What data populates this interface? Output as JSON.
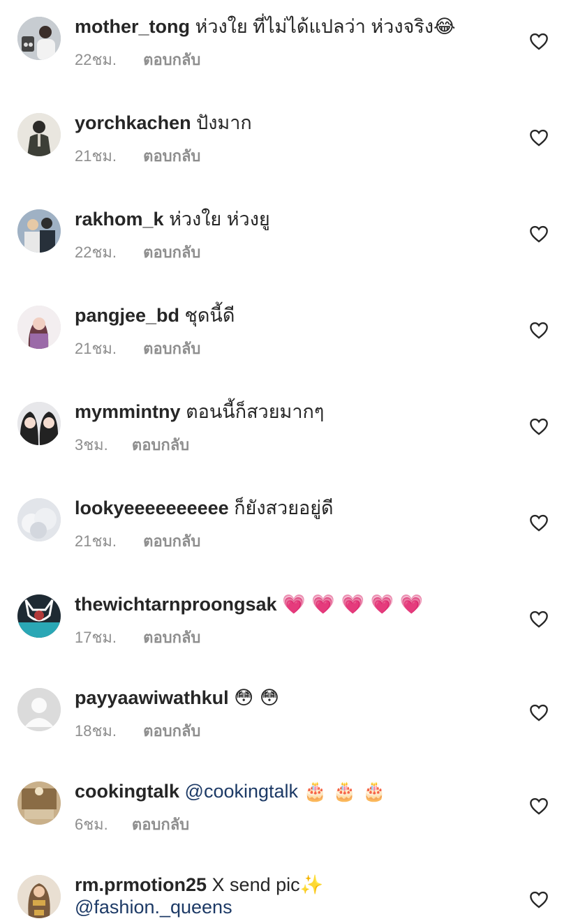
{
  "comments": [
    {
      "username": "mother_tong",
      "text": "ห่วงใย ที่ไม่ได้แปลว่า ห่วงจริง😂",
      "mention": "",
      "emoji": "",
      "time": "22ชม.",
      "reply": "ตอบกลับ",
      "avatar_color": "#9aa3ad"
    },
    {
      "username": "yorchkachen",
      "text": "ปังมาก",
      "mention": "",
      "emoji": "",
      "time": "21ชม.",
      "reply": "ตอบกลับ",
      "avatar_color": "#4d4f46"
    },
    {
      "username": "rakhom_k",
      "text": "ห่วงใย ห่วงยู",
      "mention": "",
      "emoji": "",
      "time": "22ชม.",
      "reply": "ตอบกลับ",
      "avatar_color": "#6d7e91"
    },
    {
      "username": "pangjee_bd",
      "text": "ชุดนี้ดี",
      "mention": "",
      "emoji": "",
      "time": "21ชม.",
      "reply": "ตอบกลับ",
      "avatar_color": "#b07a86"
    },
    {
      "username": "mymmintny",
      "text": "ตอนนี้ก็สวยมากๆ",
      "mention": "",
      "emoji": "",
      "time": "3ชม.",
      "reply": "ตอบกลับ",
      "avatar_color": "#5b5b62"
    },
    {
      "username": "lookyeeeeeeeeee",
      "text": "ก็ยังสวยอยู่ดี",
      "mention": "",
      "emoji": "",
      "time": "21ชม.",
      "reply": "ตอบกลับ",
      "avatar_color": "#d9dde3"
    },
    {
      "username": "thewichtarnproongsak",
      "text": "",
      "mention": "",
      "emoji": "💗 💗 💗 💗 💗",
      "time": "17ชม.",
      "reply": "ตอบกลับ",
      "avatar_color": "#2f6f7a"
    },
    {
      "username": "payyaawiwathkul",
      "text": "",
      "mention": "",
      "emoji": "😳 😳",
      "time": "18ชม.",
      "reply": "ตอบกลับ",
      "avatar_color": "#dbdbdb"
    },
    {
      "username": "cookingtalk",
      "text": "",
      "mention": "@cookingtalk",
      "emoji": "🎂 🎂 🎂",
      "time": "6ชม.",
      "reply": "ตอบกลับ",
      "avatar_color": "#a88a5b"
    },
    {
      "username": "rm.prmotion25",
      "text": "X send pic✨",
      "mention": "@fashion._queens",
      "emoji": "",
      "time": "",
      "reply": "",
      "avatar_color": "#c9a27c"
    }
  ],
  "icons": {
    "like": "heart-outline-icon",
    "avatar_placeholder": "default-avatar-icon"
  }
}
